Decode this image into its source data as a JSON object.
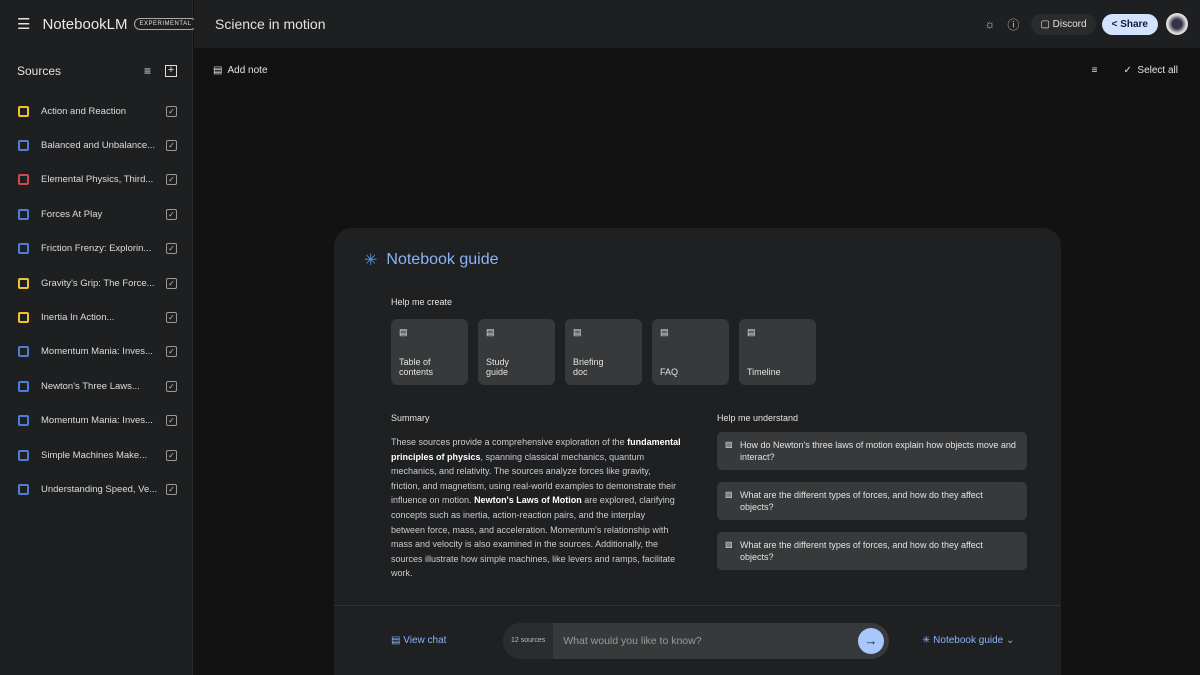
{
  "app": {
    "name": "NotebookLM",
    "badge": "EXPERIMENTAL"
  },
  "header": {
    "title": "Science in motion",
    "discord": "Discord",
    "share": "Share"
  },
  "sources": {
    "title": "Sources",
    "items": [
      {
        "label": "Action and Reaction",
        "type": "slides",
        "color": "#f2c12e"
      },
      {
        "label": "Balanced and Unbalance...",
        "type": "doc",
        "color": "#4a7fd8"
      },
      {
        "label": "Elemental Physics, Third...",
        "type": "pdf",
        "color": "#d04a4a"
      },
      {
        "label": "Forces At Play",
        "type": "doc",
        "color": "#4a7fd8"
      },
      {
        "label": "Friction Frenzy: Explorin...",
        "type": "doc",
        "color": "#4a7fd8"
      },
      {
        "label": "Gravity's Grip: The Force...",
        "type": "slides",
        "color": "#f2c12e"
      },
      {
        "label": "Inertia In Action...",
        "type": "slides",
        "color": "#f2c12e"
      },
      {
        "label": "Momentum Mania: Inves...",
        "type": "doc",
        "color": "#4a7fd8"
      },
      {
        "label": "Newton's Three Laws...",
        "type": "doc",
        "color": "#4a7fd8"
      },
      {
        "label": "Momentum Mania: Inves...",
        "type": "doc",
        "color": "#4a7fd8"
      },
      {
        "label": "Simple Machines Make...",
        "type": "doc",
        "color": "#4a7fd8"
      },
      {
        "label": "Understanding Speed, Ve...",
        "type": "doc",
        "color": "#4a7fd8"
      }
    ]
  },
  "notes": {
    "add_note": "Add note",
    "select_all": "Select all"
  },
  "guide": {
    "title": "Notebook guide",
    "help_create": "Help me create",
    "cards": [
      [
        "Table of",
        "contents"
      ],
      [
        "Study",
        "guide"
      ],
      [
        "Briefing",
        "doc"
      ],
      [
        "",
        "FAQ"
      ],
      [
        "",
        "Timeline"
      ]
    ],
    "summary_title": "Summary",
    "summary": [
      {
        "t": "These sources provide a comprehensive exploration of the "
      },
      {
        "t": "fundamental principles of physics",
        "b": true
      },
      {
        "t": ", spanning classical mechanics, quantum mechanics, and relativity. The sources analyze forces like gravity, friction, and magnetism, using real-world examples to demonstrate their influence on motion. "
      },
      {
        "t": "Newton's Laws of Motion",
        "b": true
      },
      {
        "t": " are explored, clarifying concepts such as inertia, action-reaction pairs, and the interplay between force, mass, and acceleration. Momentum's relationship with mass and velocity is also examined in the sources. Additionally, the sources illustrate how simple machines, like levers and ramps, facilitate work."
      }
    ],
    "help_understand": "Help me understand",
    "questions": [
      "How do Newton's three laws of motion explain how objects move and interact?",
      "What are the different types of forces, and how do they affect objects?",
      "What are the different types of forces, and how do they affect objects?"
    ]
  },
  "chat": {
    "view_chat": "View chat",
    "sources_count": "12 sources",
    "placeholder": "What would you like to know?",
    "guide_toggle": "Notebook guide"
  }
}
